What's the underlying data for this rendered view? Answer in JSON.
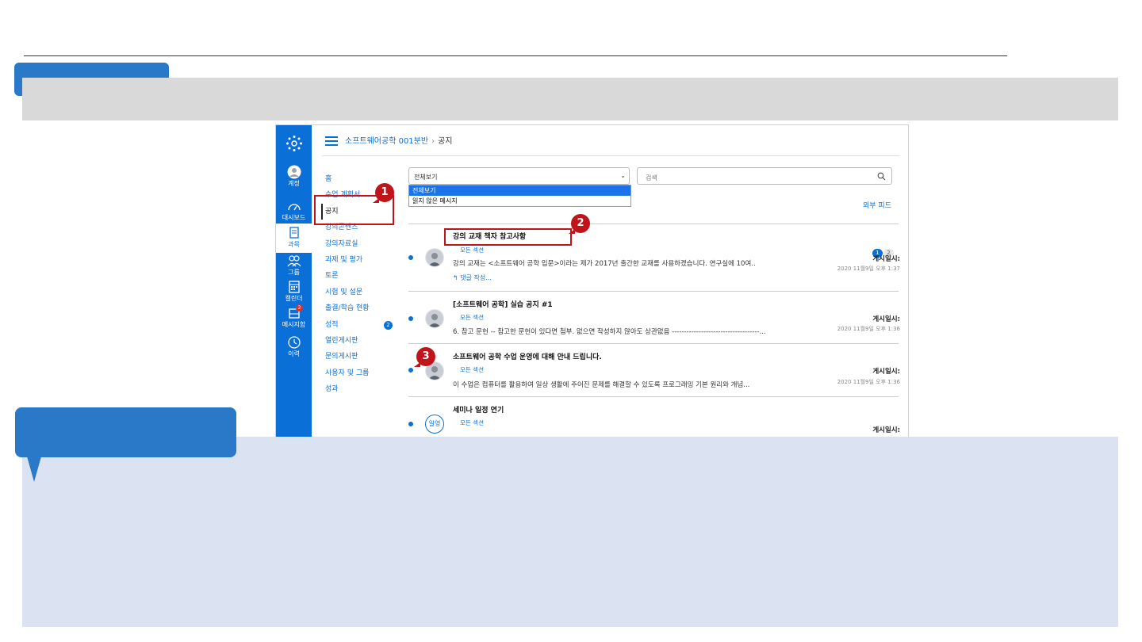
{
  "lms": {
    "global_nav": [
      {
        "label": "계정",
        "icon": "account-icon"
      },
      {
        "label": "대시보드",
        "icon": "dashboard-icon"
      },
      {
        "label": "과목",
        "icon": "courses-icon"
      },
      {
        "label": "그룹",
        "icon": "groups-icon"
      },
      {
        "label": "캘린더",
        "icon": "calendar-icon"
      },
      {
        "label": "메시지함",
        "icon": "inbox-icon",
        "badge": "2"
      },
      {
        "label": "이력",
        "icon": "history-icon"
      }
    ],
    "breadcrumb": {
      "course": "소프트웨어공학 001분반",
      "current": "공지"
    },
    "course_nav": [
      {
        "label": "홈"
      },
      {
        "label": "수업 계획서"
      },
      {
        "label": "공지"
      },
      {
        "label": "강의콘텐츠"
      },
      {
        "label": "강의자료실"
      },
      {
        "label": "과제 및 평가"
      },
      {
        "label": "토론"
      },
      {
        "label": "시험 및 설문"
      },
      {
        "label": "출결/학습 현황"
      },
      {
        "label": "성적",
        "count": "2"
      },
      {
        "label": "열린게시판"
      },
      {
        "label": "문의게시판"
      },
      {
        "label": "사용자 및 그룹"
      },
      {
        "label": "성과"
      }
    ],
    "filter": {
      "value": "전체보기",
      "options": [
        "전체보기",
        "읽지 않은 메시지"
      ]
    },
    "search": {
      "placeholder": "검색"
    },
    "external_feed": "외부 피드",
    "pagination": [
      "1",
      "2"
    ],
    "announcements": [
      {
        "title": "강의 교재 책자 참고사항",
        "section": "모든 섹션",
        "body": "강의 교재는 <소프트웨어 공학 입문>이라는 제가 2017년 출간한 교재를 사용하겠습니다. 연구실에 10여..",
        "reply": "댓글 작성...",
        "posted_label": "게시일시:",
        "posted": "2020 11월9일 오후 1:37"
      },
      {
        "title": "[소프트웨어 공학] 실습 공지 #1",
        "section": "모든 섹션",
        "body": "6. 참고 문헌 -- 참고한 문헌이 있다면 첨부. 없으면 작성하지 않아도 상관없음 ------------------------------------...",
        "posted_label": "게시일시:",
        "posted": "2020 11월9일 오후 1:36"
      },
      {
        "title": "소프트웨어 공학 수업 운영에 대해 안내 드립니다.",
        "section": "모든 섹션",
        "body": "이 수업은 컴퓨터를 활용하여 일상 생활에 주어진 문제를 해결할 수 있도록 프로그래밍 기본 원리와 개념...",
        "posted_label": "게시일시:",
        "posted": "2020 11월9일 오후 1:36"
      },
      {
        "title": "세미나 일정 연기",
        "section": "모든 섹션",
        "avatar_text": "일영",
        "posted_label": "게시일시:"
      }
    ],
    "markers": [
      "1",
      "2",
      "3"
    ]
  }
}
